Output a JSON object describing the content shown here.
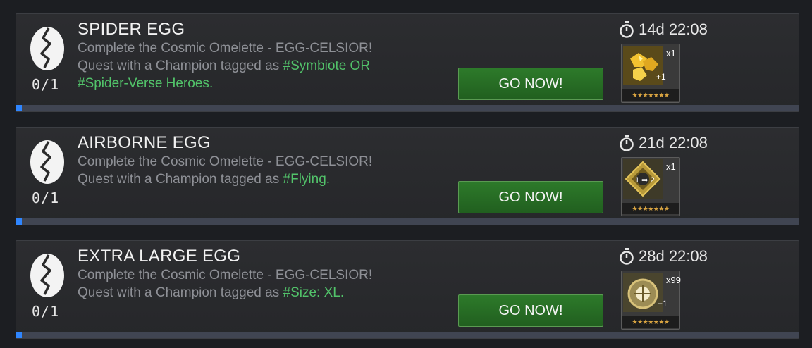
{
  "quests": [
    {
      "title": "SPIDER EGG",
      "line1": "Complete the Cosmic Omelette - EGG-CELSIOR!",
      "line2_prefix": "Quest with a Champion tagged as ",
      "line2_tag": "#Symbiote OR",
      "line3_tag": "#Spider-Verse Heroes",
      "line3_suffix": ".",
      "count": "0/1",
      "timer": "14d 22:08",
      "button": "GO NOW!",
      "reward": {
        "icon": "gold-crystal-shards-icon",
        "qty": "x1",
        "badge": "+1",
        "stars": "★★★★★★★"
      },
      "progress": 0.0
    },
    {
      "title": "AIRBORNE EGG",
      "line1": "Complete the Cosmic Omelette - EGG-CELSIOR!",
      "line2_prefix": "Quest with a Champion tagged as ",
      "line2_tag": "#Flying",
      "line2_suffix": ".",
      "count": "0/1",
      "timer": "21d 22:08",
      "button": "GO NOW!",
      "reward": {
        "icon": "rank-up-gem-icon",
        "qty": "x1",
        "badge": "1 ➡ 2",
        "stars": "★★★★★★★"
      },
      "progress": 0.0
    },
    {
      "title": "EXTRA LARGE EGG",
      "line1": "Complete the Cosmic Omelette - EGG-CELSIOR!",
      "line2_prefix": "Quest with a Champion tagged as ",
      "line2_tag": "#Size: XL",
      "line2_suffix": ".",
      "count": "0/1",
      "timer": "28d 22:08",
      "button": "GO NOW!",
      "reward": {
        "icon": "sig-stone-icon",
        "qty": "x99",
        "badge": "+1",
        "stars": "★★★★★★★"
      },
      "progress": 0.0
    }
  ],
  "colors": {
    "tag": "#52c36a",
    "button": "#2d7a2a",
    "progress": "#2f86ff",
    "stars": "#d9a441"
  }
}
